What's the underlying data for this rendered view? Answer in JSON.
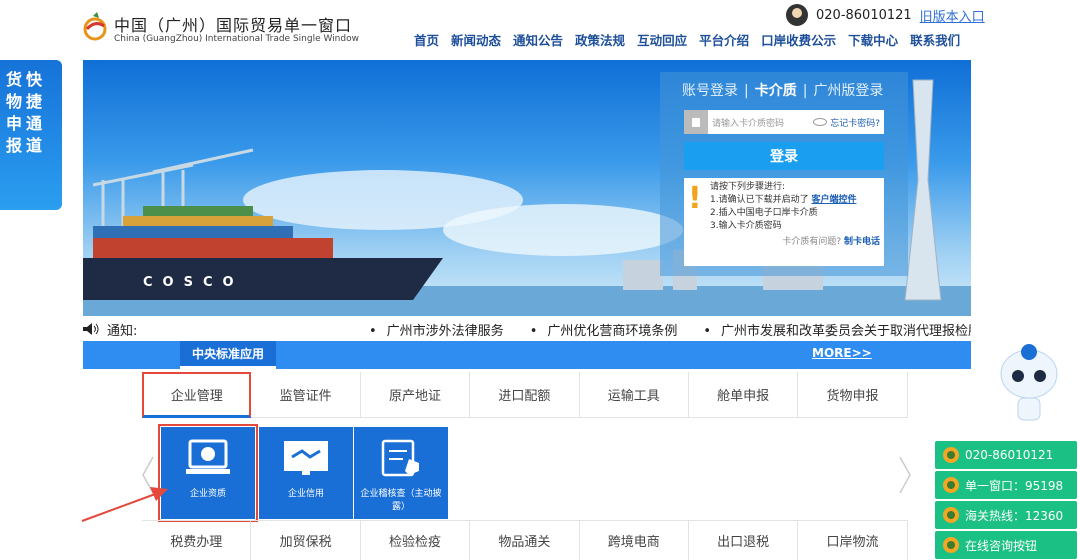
{
  "header": {
    "site_title": "中国（广州）国际贸易单一窗口",
    "site_subtitle": "China (GuangZhou) International Trade Single Window",
    "phone": "020-86010121",
    "old_version_link": "旧版本入口",
    "nav": [
      "首页",
      "新闻动态",
      "通知公告",
      "政策法规",
      "互动回应",
      "平台介绍",
      "口岸收费公示",
      "下载中心",
      "联系我们"
    ]
  },
  "left_ad": {
    "col1": [
      "货",
      "物",
      "申",
      "报"
    ],
    "col2": [
      "快",
      "捷",
      "通",
      "道"
    ]
  },
  "banner": {
    "ship_text": "COSCO"
  },
  "login": {
    "tab_account": "账号登录",
    "tab_card": "卡介质",
    "tab_gz": "广州版登录",
    "password_placeholder": "请输入卡介质密码",
    "forgot_link": "忘记卡密码?",
    "login_button": "登录",
    "steps_title": "请按下列步骤进行:",
    "step1_pre": "1.请确认已下载并启动了",
    "step1_link": "客户端控件",
    "step2": "2.插入中国电子口岸卡介质",
    "step3": "3.输入卡介质密码",
    "help_pre": "卡介质有问题?",
    "help_link": "制卡电话"
  },
  "notice": {
    "label": "通知:",
    "items": [
      "广州市涉外法律服务",
      "广州优化营商环境条例",
      "广州市发展和改革委员会关于取消代理报检服"
    ]
  },
  "central_bar": {
    "label": "中央标准应用",
    "more": "MORE>>"
  },
  "tabs": [
    "企业管理",
    "监管证件",
    "原产地证",
    "进口配额",
    "运输工具",
    "舱单申报",
    "货物申报"
  ],
  "services": [
    {
      "label": "企业资质",
      "icon": "enterprise-qualification-icon"
    },
    {
      "label": "企业信用",
      "icon": "enterprise-credit-icon"
    },
    {
      "label": "企业稽核查（主动披露）",
      "icon": "enterprise-audit-icon"
    }
  ],
  "bottom_tabs": [
    "税费办理",
    "加贸保税",
    "检验检疫",
    "物品通关",
    "跨境电商",
    "出口退税",
    "口岸物流"
  ],
  "hotlines": [
    {
      "text": "020-86010121"
    },
    {
      "text": "单一窗口：95198"
    },
    {
      "text": "海关热线：12360"
    },
    {
      "text": "在线咨询按钮"
    }
  ],
  "colors": {
    "primary": "#1a6fd6",
    "highlight": "#e4493b",
    "hotline": "#1bc184"
  }
}
